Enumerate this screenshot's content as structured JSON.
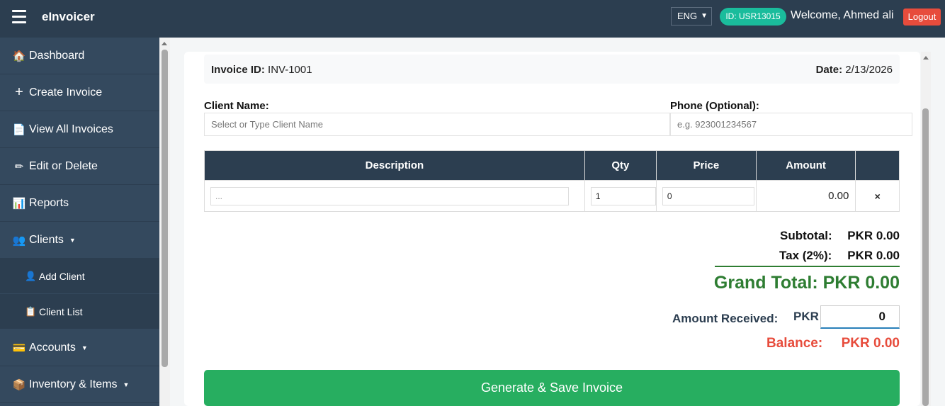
{
  "app": {
    "title": "eInvoicer"
  },
  "header": {
    "language": "ENG",
    "user_id": "ID: USR13015",
    "welcome": "Welcome, Ahmed ali",
    "logout": "Logout"
  },
  "sidebar": {
    "items": [
      {
        "label": "Dashboard",
        "icon": "home-icon"
      },
      {
        "label": "Create Invoice",
        "icon": "plus-icon"
      },
      {
        "label": "View All Invoices",
        "icon": "document-icon"
      },
      {
        "label": "Edit or Delete",
        "icon": "pencil-icon"
      },
      {
        "label": "Reports",
        "icon": "chart-icon"
      },
      {
        "label": "Clients",
        "icon": "users-icon",
        "expanded": true
      },
      {
        "label": "Accounts",
        "icon": "card-icon"
      },
      {
        "label": "Inventory & Items",
        "icon": "box-icon"
      }
    ],
    "clients_sub": [
      {
        "label": "Add Client",
        "icon": "user-icon"
      },
      {
        "label": "Client List",
        "icon": "clipboard-icon"
      }
    ]
  },
  "invoice": {
    "id_label": "Invoice ID:",
    "id_value": "INV-1001",
    "date_label": "Date:",
    "date_value": "2/13/2026"
  },
  "form": {
    "client_label": "Client Name:",
    "client_placeholder": "Select or Type Client Name",
    "phone_label": "Phone (Optional):",
    "phone_placeholder": "e.g. 923001234567"
  },
  "table": {
    "headers": [
      "Description",
      "Qty",
      "Price",
      "Amount"
    ],
    "rows": [
      {
        "description_placeholder": "...",
        "qty": "1",
        "price": "0",
        "amount": "0.00",
        "remove": "×"
      }
    ]
  },
  "totals": {
    "subtotal_label": "Subtotal:",
    "subtotal_value": "PKR 0.00",
    "tax_label": "Tax (2%):",
    "tax_value": "PKR 0.00",
    "grand_total": "Grand Total: PKR 0.00",
    "amount_received_label": "Amount Received:",
    "amount_received_currency": "PKR",
    "amount_received_value": "0",
    "balance_label": "Balance:",
    "balance_value": "PKR 0.00"
  },
  "actions": {
    "generate": "Generate & Save Invoice"
  },
  "colors": {
    "topbar": "#2c3e50",
    "sidebar": "#34495e",
    "accent_green": "#27ae60",
    "grand_total": "#2e7d32",
    "danger": "#e74c3c",
    "badge": "#1abc9c"
  }
}
